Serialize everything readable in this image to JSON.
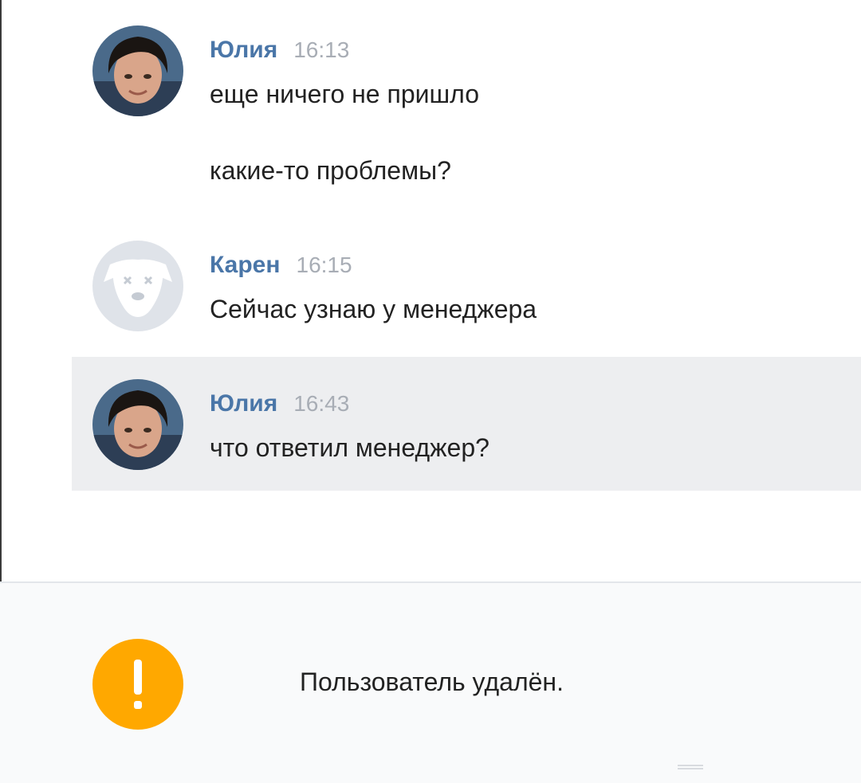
{
  "messages": [
    {
      "author": "Юлия",
      "time": "16:13",
      "lines": [
        "еще ничего не пришло",
        "какие-то проблемы?"
      ]
    },
    {
      "author": "Карен",
      "time": "16:15",
      "lines": [
        "Сейчас узнаю у менеджера"
      ]
    },
    {
      "author": "Юлия",
      "time": "16:43",
      "lines": [
        "что ответил менеджер?"
      ]
    }
  ],
  "notice": {
    "icon": "exclamation-icon",
    "text": "Пользователь удалён.",
    "color": "#ffa800"
  },
  "colors": {
    "author": "#4a76a8",
    "time": "#a8adb5",
    "highlight_bg": "#edeef0"
  }
}
